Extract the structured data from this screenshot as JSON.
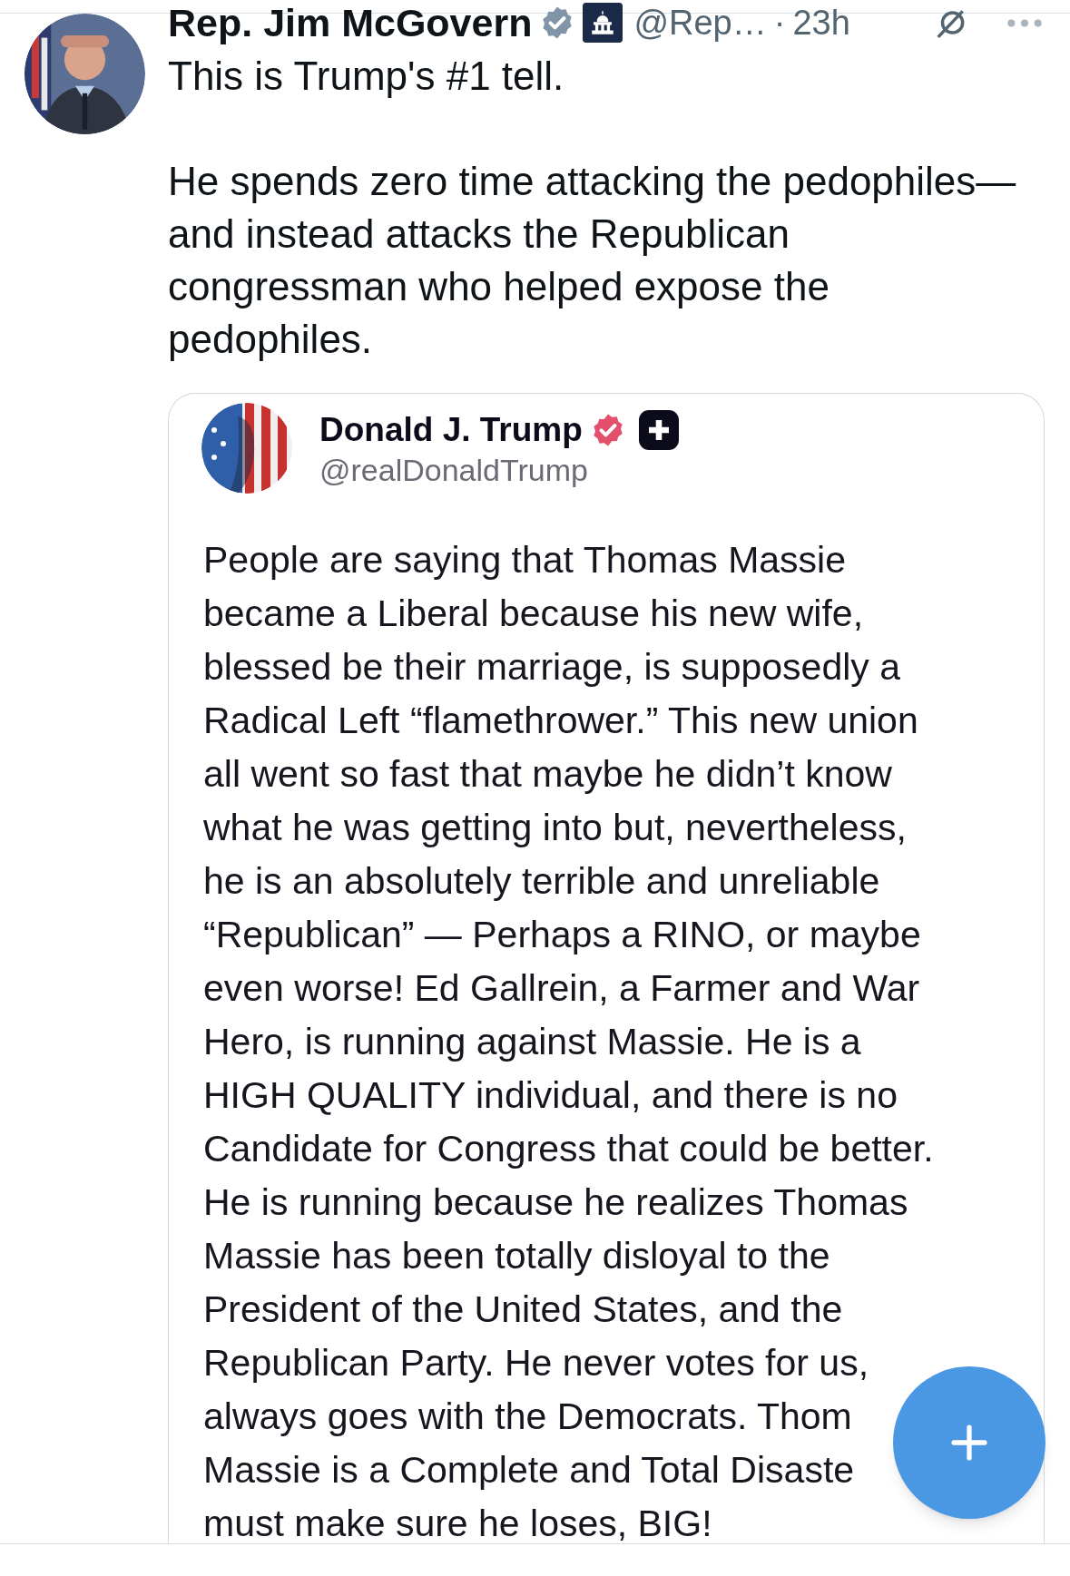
{
  "post": {
    "author": "Rep. Jim McGovern",
    "handle": "@Rep…",
    "separator": "·",
    "time": "23h",
    "paragraphs": [
      "This is Trump's #1 tell.",
      "He spends zero time attacking the pedophiles—and instead attacks the Republican congressman who helped expose the pedophiles."
    ]
  },
  "quote": {
    "author": "Donald J. Trump",
    "handle": "@realDonaldTrump",
    "lines": [
      "People are saying that Thomas Massie",
      "became a Liberal because his new wife,",
      "blessed be their marriage, is supposedly a",
      "Radical Left “flamethrower.” This new union",
      "all went so fast that maybe he didn’t know",
      "what he was getting into but, nevertheless,",
      "he is an absolutely terrible and unreliable",
      "“Republican” — Perhaps a RINO, or maybe",
      "even worse! Ed Gallrein, a Farmer and War",
      "Hero, is running against Massie. He is a",
      "HIGH QUALITY individual, and there is no",
      "Candidate for Congress that could be better.",
      "He is running because he realizes Thomas",
      "Massie has been totally disloyal to the",
      "President of the United States, and the",
      "Republican Party. He never votes for us,",
      "always goes with the Democrats. Thom",
      "Massie is a Complete and Total Disaste",
      "must make sure he loses, BIG!"
    ]
  }
}
